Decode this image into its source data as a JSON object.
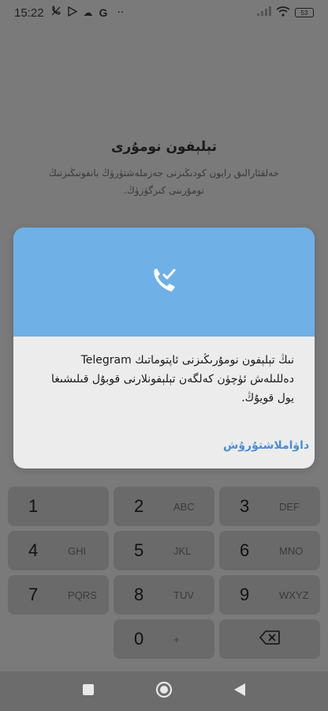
{
  "status_bar": {
    "time": "15:22",
    "cloud_icon": "☁",
    "g_label": "G",
    "dots": "··",
    "battery": "53"
  },
  "page": {
    "title": "تېلېفون نومۇرى",
    "subtitle": "خەلقئارالىق رايون كودىڭىزنى جەزملەشتۈرۈڭ يانفونىڭىزنىڭ نومۇرىنى كىرگۈزۈڭ."
  },
  "dialog": {
    "header_icon": "phone-check-icon",
    "header_color": "#6fb0e6",
    "message": "نىڭ تېلېفون نومۇرىڭىزنى ئاپتوماتىك Telegram دەللىلەش ئۈچۈن كەلگەن تېلېفونلارنى قوبۇل قىلىشىغا يول قويۇڭ.",
    "action_label": "داۋاملاشتۇرۇش",
    "accent_color": "#4a8ed3"
  },
  "keypad": {
    "keys": [
      {
        "digit": "1",
        "letters": ""
      },
      {
        "digit": "2",
        "letters": "ABC"
      },
      {
        "digit": "3",
        "letters": "DEF"
      },
      {
        "digit": "4",
        "letters": "GHI"
      },
      {
        "digit": "5",
        "letters": "JKL"
      },
      {
        "digit": "6",
        "letters": "MNO"
      },
      {
        "digit": "7",
        "letters": "PQRS"
      },
      {
        "digit": "8",
        "letters": "TUV"
      },
      {
        "digit": "9",
        "letters": "WXYZ"
      },
      {
        "digit": "0",
        "letters": "+"
      }
    ],
    "backspace_icon": "backspace-icon"
  },
  "nav_bar": {
    "recents_icon": "square-icon",
    "home_icon": "circle-icon",
    "back_icon": "triangle-back-icon"
  }
}
